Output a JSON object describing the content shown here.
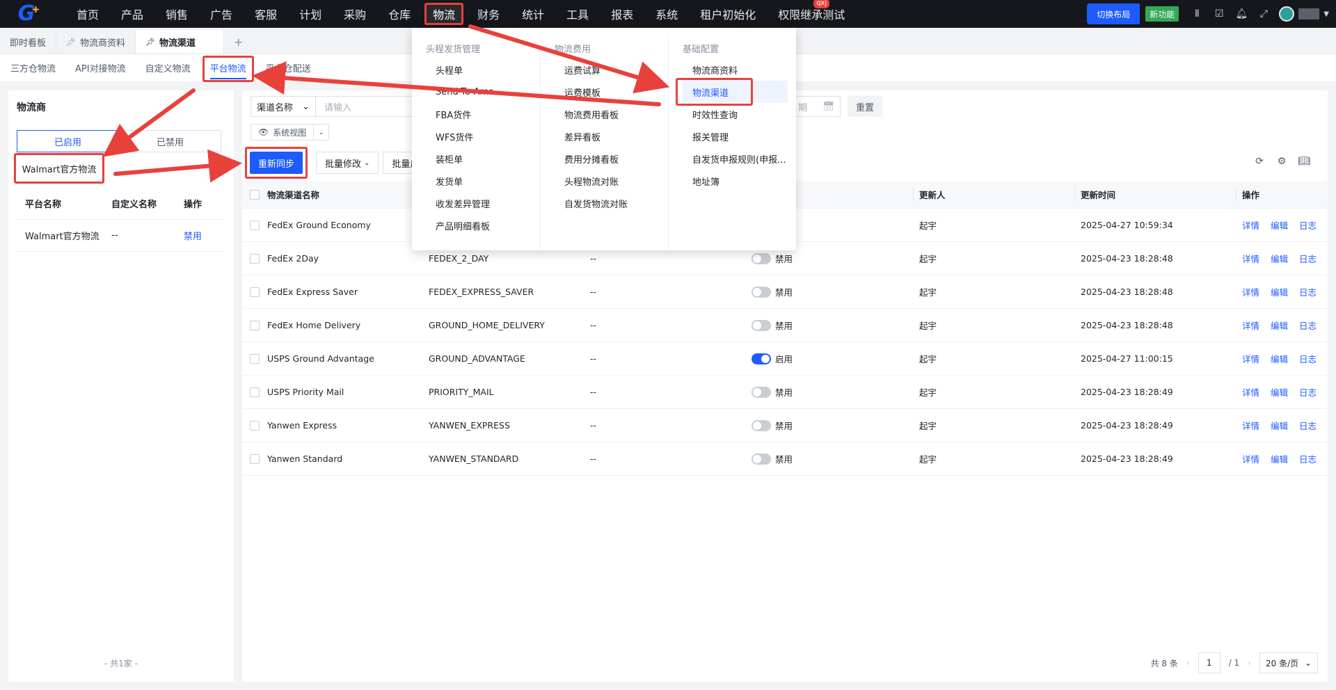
{
  "topnav": {
    "logo": "G",
    "items": [
      "首页",
      "产品",
      "销售",
      "广告",
      "客服",
      "计划",
      "采购",
      "仓库",
      "物流",
      "财务",
      "统计",
      "工具",
      "报表",
      "系统",
      "租户初始化",
      "权限继承测试"
    ],
    "active_index": 8,
    "badge": "qxj",
    "switch_layout": "切换布局",
    "new_feature": "新功能"
  },
  "page_tabs": [
    "即时看板",
    "物流商资料",
    "物流渠道"
  ],
  "active_page_tab": 2,
  "sub_tabs": [
    "三方仓物流",
    "API对接物流",
    "自定义物流",
    "平台物流",
    "平台仓配送"
  ],
  "active_sub_tab": 3,
  "left": {
    "title": "物流商",
    "segments": [
      "已启用",
      "已禁用"
    ],
    "selected_carrier": "Walmart官方物流",
    "headers": [
      "平台名称",
      "自定义名称",
      "操作"
    ],
    "rows": [
      {
        "platform": "Walmart官方物流",
        "custom": "--",
        "action": "禁用"
      }
    ],
    "footer": "- 共1家 -"
  },
  "filter": {
    "field": "渠道名称",
    "placeholder": "请输入",
    "date_placeholder": "期",
    "reset": "重置",
    "view": "系统视图"
  },
  "actions": {
    "resync": "重新同步",
    "batch_edit": "批量修改",
    "batch_enable": "批量启用"
  },
  "table": {
    "headers": [
      "物流渠道名称",
      "",
      "",
      "",
      "更新人",
      "更新时间",
      "操作"
    ],
    "row_actions": [
      "详情",
      "编辑",
      "日志"
    ],
    "rows": [
      {
        "name": "FedEx Ground Economy",
        "code": "",
        "remark": "",
        "status": "",
        "enabled": null,
        "updater": "起宇",
        "time": "2025-04-27 10:59:34"
      },
      {
        "name": "FedEx 2Day",
        "code": "FEDEX_2_DAY",
        "remark": "--",
        "status": "禁用",
        "enabled": false,
        "updater": "起宇",
        "time": "2025-04-23 18:28:48"
      },
      {
        "name": "FedEx Express Saver",
        "code": "FEDEX_EXPRESS_SAVER",
        "remark": "--",
        "status": "禁用",
        "enabled": false,
        "updater": "起宇",
        "time": "2025-04-23 18:28:48"
      },
      {
        "name": "FedEx Home Delivery",
        "code": "GROUND_HOME_DELIVERY",
        "remark": "--",
        "status": "禁用",
        "enabled": false,
        "updater": "起宇",
        "time": "2025-04-23 18:28:48"
      },
      {
        "name": "USPS Ground Advantage",
        "code": "GROUND_ADVANTAGE",
        "remark": "--",
        "status": "启用",
        "enabled": true,
        "updater": "起宇",
        "time": "2025-04-27 11:00:15"
      },
      {
        "name": "USPS Priority Mail",
        "code": "PRIORITY_MAIL",
        "remark": "--",
        "status": "禁用",
        "enabled": false,
        "updater": "起宇",
        "time": "2025-04-23 18:28:49"
      },
      {
        "name": "Yanwen Express",
        "code": "YANWEN_EXPRESS",
        "remark": "--",
        "status": "禁用",
        "enabled": false,
        "updater": "起宇",
        "time": "2025-04-23 18:28:49"
      },
      {
        "name": "Yanwen Standard",
        "code": "YANWEN_STANDARD",
        "remark": "--",
        "status": "禁用",
        "enabled": false,
        "updater": "起宇",
        "time": "2025-04-23 18:28:49"
      }
    ]
  },
  "pager": {
    "total": "共 8 条",
    "page": "1",
    "pages": "/ 1",
    "size": "20 条/页"
  },
  "mega_menu": {
    "columns": [
      {
        "title": "头程发货管理",
        "items": [
          "头程单",
          "Send-To-Ama...",
          "FBA货件",
          "WFS货件",
          "装柜单",
          "发货单",
          "收发差异管理",
          "产品明细看板"
        ]
      },
      {
        "title": "物流费用",
        "items": [
          "运费试算",
          "运费模板",
          "物流费用看板",
          "差异看板",
          "费用分摊看板",
          "头程物流对账",
          "自发货物流对账"
        ]
      },
      {
        "title": "基础配置",
        "items": [
          "物流商资料",
          "物流渠道",
          "时效性查询",
          "报关管理",
          "自发货申报规则(申报...",
          "地址簿"
        ]
      }
    ],
    "selected": {
      "column": 2,
      "index": 1
    }
  },
  "colors": {
    "accent": "#1e5bff",
    "highlight": "#e8413c",
    "nav_bg": "#15171c"
  }
}
